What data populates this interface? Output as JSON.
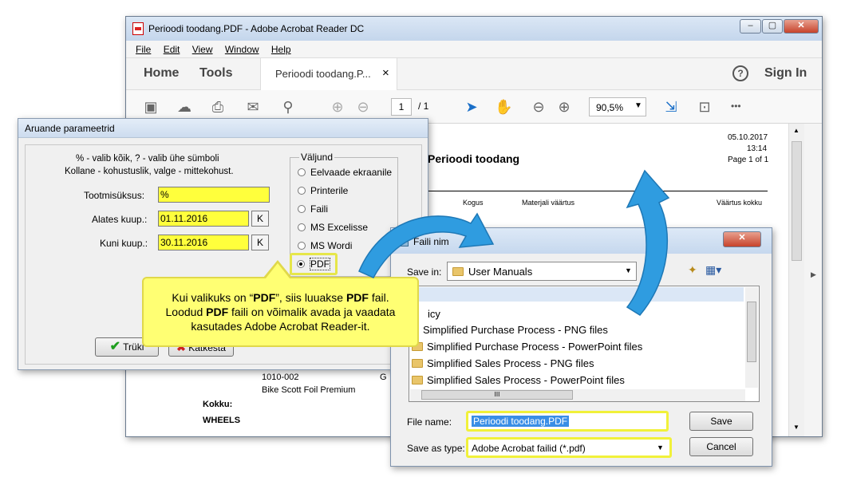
{
  "acrobat": {
    "title": "Perioodi toodang.PDF - Adobe Acrobat Reader DC",
    "menu": [
      "File",
      "Edit",
      "View",
      "Window",
      "Help"
    ],
    "nav_home": "Home",
    "nav_tools": "Tools",
    "tab_label": "Perioodi toodang.P...",
    "tab_close": "×",
    "help": "?",
    "sign_in": "Sign In",
    "page_num": "1",
    "page_total": "/ 1",
    "zoom": "90,5%",
    "more": "•••"
  },
  "doc": {
    "date": "05.10.2017",
    "time": "13:14",
    "page": "Page 1 of 1",
    "title": "Perioodi toodang",
    "col_kogus": "Kogus",
    "col_materjali": "Materjali väärtus",
    "col_vaartus": "Väärtus kokku",
    "code": "1010-002",
    "code_tail": "G",
    "product": "Bike Scott Foil Premium",
    "kokku": "Kokku:",
    "wheels": "WHEELS"
  },
  "aruande": {
    "title": "Aruande parameetrid",
    "hint1": "% - valib kõik, ? - valib ühe sümboli",
    "hint2": "Kollane - kohustuslik, valge - mittekohust.",
    "tootmisuksus_label": "Tootmisüksus:",
    "tootmisuksus_value": "%",
    "alates_label": "Alates kuup.:",
    "alates_value": "01.11.2016",
    "kuni_label": "Kuni kuup.:",
    "kuni_value": "30.11.2016",
    "k_btn": "K",
    "group_label": "Väljund",
    "options": [
      "Eelvaade ekraanile",
      "Printerile",
      "Faili",
      "MS Excelisse",
      "MS Wordi",
      "PDF"
    ],
    "selected": "PDF",
    "print_btn": "Trüki",
    "cancel_btn": "Katkesta"
  },
  "callout": {
    "line1_a": "Kui valikuks on “",
    "line1_b": "PDF",
    "line1_c": "”, siis luuakse ",
    "line1_d": "PDF",
    "line1_e": " fail.",
    "line2_a": "Loodud ",
    "line2_b": "PDF",
    "line2_c": " faili on võimalik avada ja vaadata",
    "line3": "kasutades Adobe Acrobat Reader-it."
  },
  "save_dialog": {
    "title": "Faili nim",
    "save_in_label": "Save in:",
    "save_in_value": "User Manuals",
    "list": [
      "icy",
      "Simplified Purchase Process - PNG files",
      "Simplified Purchase Process - PowerPoint files",
      "Simplified Sales Process - PNG files",
      "Simplified Sales Process - PowerPoint files"
    ],
    "hscroll": "III",
    "file_name_label": "File name:",
    "file_name_value": "Perioodi toodang.PDF",
    "save_as_label": "Save as type:",
    "save_as_value": "Adobe Acrobat failid (*.pdf)",
    "save_btn": "Save",
    "cancel_btn": "Cancel"
  },
  "colors": {
    "highlight_yellow": "#ffff3c",
    "callout_yellow": "#ffff73",
    "arrow_blue": "#2f9ce0"
  }
}
